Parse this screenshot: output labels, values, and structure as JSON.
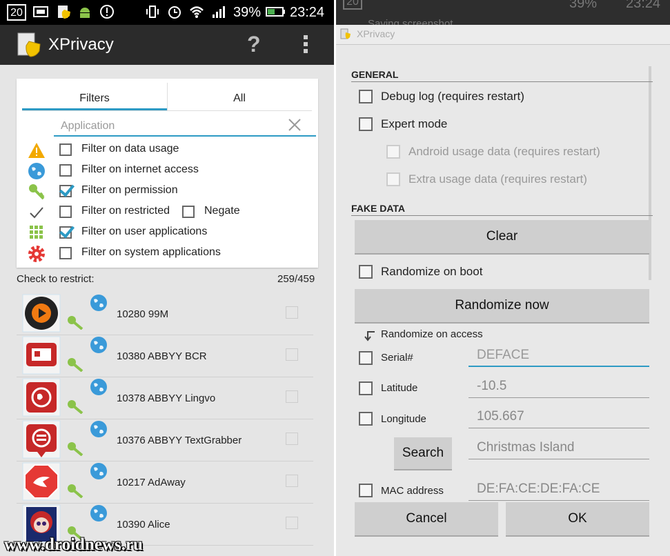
{
  "left": {
    "status": {
      "date_badge": "20",
      "battery": "39%",
      "time": "23:24"
    },
    "actionbar": {
      "title": "XPrivacy",
      "help": "?"
    },
    "tabs": [
      "Filters",
      "All"
    ],
    "search": {
      "placeholder": "Application",
      "value": ""
    },
    "filters": [
      {
        "label": "Filter on data usage",
        "checked": false,
        "icon": "warning-icon"
      },
      {
        "label": "Filter on internet access",
        "checked": false,
        "icon": "globe-icon"
      },
      {
        "label": "Filter on permission",
        "checked": true,
        "icon": "key-icon"
      },
      {
        "label": "Filter on restricted",
        "checked": false,
        "icon": "check-mark-icon"
      },
      {
        "label": "Filter on user applications",
        "checked": true,
        "icon": "grid-icon"
      },
      {
        "label": "Filter on system applications",
        "checked": false,
        "icon": "gear-icon"
      }
    ],
    "negate_label": "Negate",
    "check_to_restrict": "Check to restrict:",
    "count": "259/459",
    "apps": [
      {
        "label": "10280 99M",
        "icon": "play-app-icon"
      },
      {
        "label": "10380 ABBYY BCR",
        "icon": "business-card-app-icon"
      },
      {
        "label": "10378 ABBYY Lingvo",
        "icon": "globe-app-icon"
      },
      {
        "label": "10376 ABBYY TextGrabber",
        "icon": "textgrabber-app-icon"
      },
      {
        "label": "10217 AdAway",
        "icon": "stop-sign-app-icon"
      },
      {
        "label": "10390 Alice",
        "icon": "alice-app-icon"
      }
    ],
    "watermark": "www.droidnews.ru"
  },
  "right": {
    "status": {
      "date_badge": "20",
      "battery": "39%",
      "time": "23:24",
      "notification": "Saving screenshot"
    },
    "dialog_title": "XPrivacy",
    "general_header": "GENERAL",
    "debug_log": "Debug log (requires restart)",
    "expert_mode": "Expert mode",
    "android_usage": "Android usage data (requires restart)",
    "extra_usage": "Extra usage data (requires restart)",
    "fake_header": "FAKE DATA",
    "clear": "Clear",
    "randomize_boot": "Randomize on boot",
    "randomize_now": "Randomize now",
    "randomize_access": "Randomize on access",
    "serial": {
      "label": "Serial#",
      "value": "",
      "placeholder": "DEFACE"
    },
    "latitude": {
      "label": "Latitude",
      "value": "-10.5"
    },
    "longitude": {
      "label": "Longitude",
      "value": "105.667"
    },
    "search": "Search",
    "location": "Christmas Island",
    "mac": {
      "label": "MAC address",
      "value": "DE:FA:CE:DE:FA:CE"
    },
    "cancel": "Cancel",
    "ok": "OK"
  },
  "colors": {
    "accent": "#2d9ac4",
    "actionbar": "#2b2b2b",
    "battery_green": "#4caf50"
  }
}
